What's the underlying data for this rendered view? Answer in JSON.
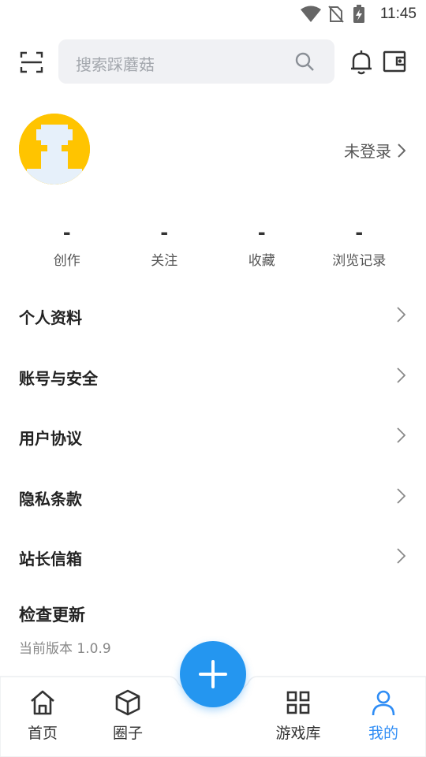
{
  "status_bar": {
    "time": "11:45"
  },
  "search": {
    "placeholder": "搜索踩蘑菇"
  },
  "profile": {
    "login_label": "未登录"
  },
  "stats": [
    {
      "value": "-",
      "label": "创作"
    },
    {
      "value": "-",
      "label": "关注"
    },
    {
      "value": "-",
      "label": "收藏"
    },
    {
      "value": "-",
      "label": "浏览记录"
    }
  ],
  "menu": [
    {
      "label": "个人资料"
    },
    {
      "label": "账号与安全"
    },
    {
      "label": "用户协议"
    },
    {
      "label": "隐私条款"
    },
    {
      "label": "站长信箱"
    }
  ],
  "update": {
    "title": "检查更新",
    "version": "当前版本 1.0.9"
  },
  "nav": [
    {
      "label": "首页"
    },
    {
      "label": "圈子"
    },
    {
      "label": "游戏库"
    },
    {
      "label": "我的"
    }
  ],
  "colors": {
    "accent": "#2496f0",
    "active_tab": "#2f8df5",
    "avatar_bg": "#ffc400"
  }
}
